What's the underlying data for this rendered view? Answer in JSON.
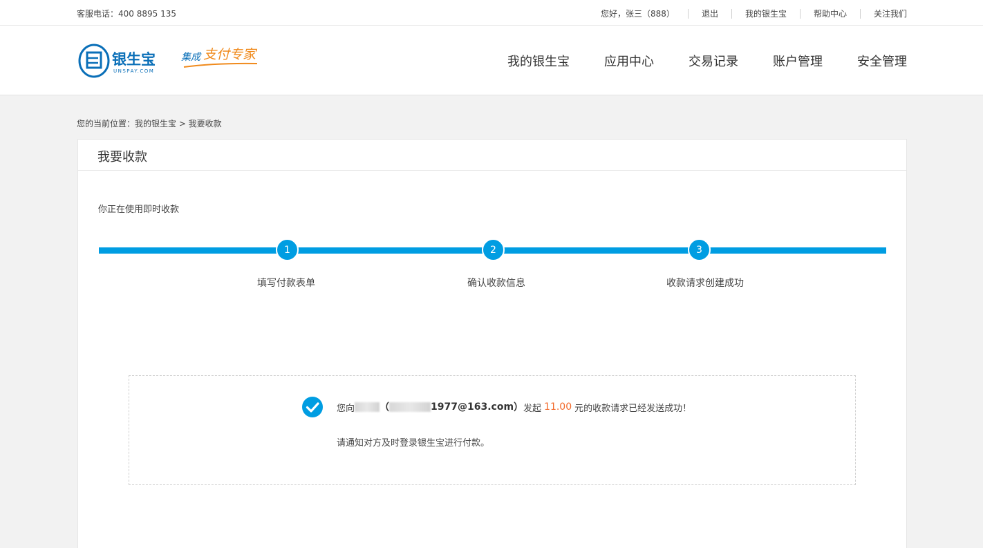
{
  "topbar": {
    "phone": "客服电话：400 8895 135",
    "greeting": "您好，张三（888）",
    "links": [
      "退出",
      "我的银生宝",
      "帮助中心",
      "关注我们"
    ]
  },
  "header": {
    "logo_text": "银生宝",
    "logo_sub": "UNSPAY.COM",
    "slogan_a": "集成",
    "slogan_b": "支付专家",
    "nav": [
      "我的银生宝",
      "应用中心",
      "交易记录",
      "账户管理",
      "安全管理"
    ]
  },
  "breadcrumb": "您的当前位置：我的银生宝 > 我要收款",
  "panel": {
    "title": "我要收款",
    "usage": "你正在使用即时收款",
    "steps": [
      {
        "num": "1",
        "label": "填写付款表单"
      },
      {
        "num": "2",
        "label": "确认收款信息"
      },
      {
        "num": "3",
        "label": "收款请求创建成功"
      }
    ]
  },
  "result": {
    "prefix": "您向",
    "email_suffix": "1977@163.com",
    "paren_open": "（",
    "paren_close": "）",
    "mid": "发起",
    "amount": "11.00",
    "suffix": "元的收款请求已经发送成功！",
    "note": "请通知对方及时登录银生宝进行付款。"
  },
  "colors": {
    "accent": "#009de2",
    "amount": "#f2692a"
  }
}
